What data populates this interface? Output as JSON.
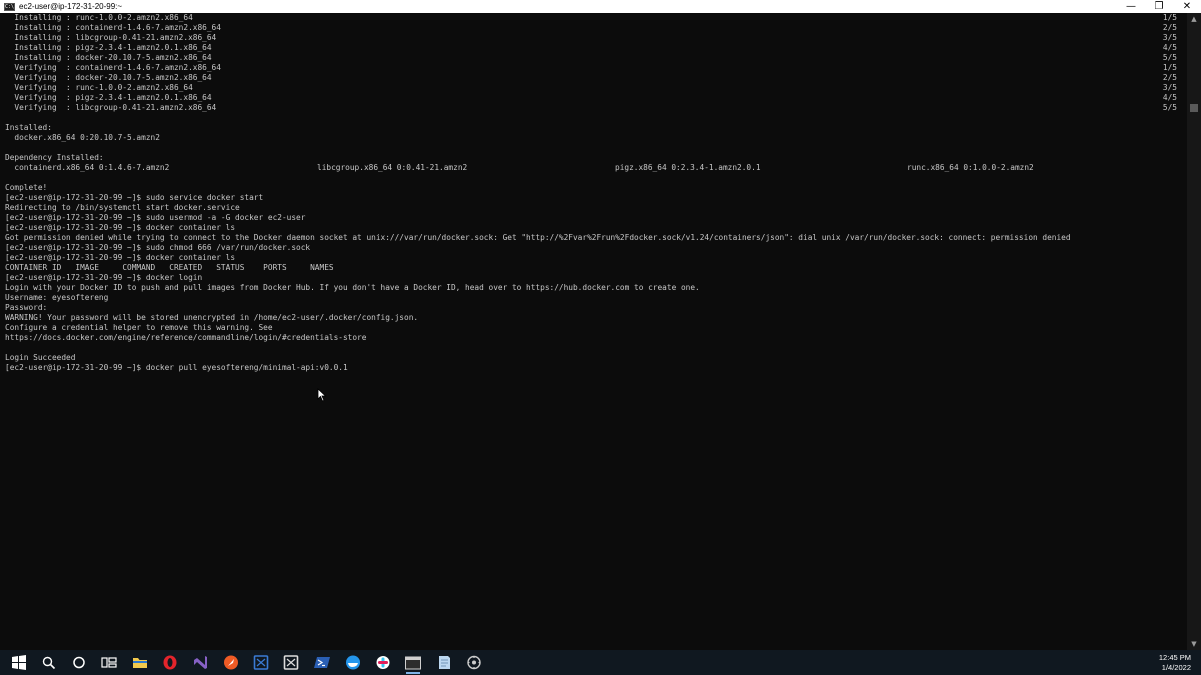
{
  "window": {
    "title": "ec2-user@ip-172-31-20-99:~",
    "app_icon_text": "C:\\",
    "minimize": "—",
    "restore": "❐",
    "close": "✕"
  },
  "terminal": {
    "lines": [
      "  Installing : runc-1.0.0-2.amzn2.x86_64",
      "  Installing : containerd-1.4.6-7.amzn2.x86_64",
      "  Installing : libcgroup-0.41-21.amzn2.x86_64",
      "  Installing : pigz-2.3.4-1.amzn2.0.1.x86_64",
      "  Installing : docker-20.10.7-5.amzn2.x86_64",
      "  Verifying  : containerd-1.4.6-7.amzn2.x86_64",
      "  Verifying  : docker-20.10.7-5.amzn2.x86_64",
      "  Verifying  : runc-1.0.0-2.amzn2.x86_64",
      "  Verifying  : pigz-2.3.4-1.amzn2.0.1.x86_64",
      "  Verifying  : libcgroup-0.41-21.amzn2.x86_64",
      "",
      "Installed:",
      "  docker.x86_64 0:20.10.7-5.amzn2",
      "",
      "Dependency Installed:",
      "",
      "",
      "Complete!",
      "[ec2-user@ip-172-31-20-99 ~]$ sudo service docker start",
      "Redirecting to /bin/systemctl start docker.service",
      "[ec2-user@ip-172-31-20-99 ~]$ sudo usermod -a -G docker ec2-user",
      "[ec2-user@ip-172-31-20-99 ~]$ docker container ls",
      "Got permission denied while trying to connect to the Docker daemon socket at unix:///var/run/docker.sock: Get \"http://%2Fvar%2Frun%2Fdocker.sock/v1.24/containers/json\": dial unix /var/run/docker.sock: connect: permission denied",
      "[ec2-user@ip-172-31-20-99 ~]$ sudo chmod 666 /var/run/docker.sock",
      "[ec2-user@ip-172-31-20-99 ~]$ docker container ls",
      "CONTAINER ID   IMAGE     COMMAND   CREATED   STATUS    PORTS     NAMES",
      "[ec2-user@ip-172-31-20-99 ~]$ docker login",
      "Login with your Docker ID to push and pull images from Docker Hub. If you don't have a Docker ID, head over to https://hub.docker.com to create one.",
      "Username: eyesoftereng",
      "Password:",
      "WARNING! Your password will be stored unencrypted in /home/ec2-user/.docker/config.json.",
      "Configure a credential helper to remove this warning. See",
      "https://docs.docker.com/engine/reference/commandline/login/#credentials-store",
      "",
      "Login Succeeded",
      "[ec2-user@ip-172-31-20-99 ~]$ docker pull eyesoftereng/minimal-api:v0.0.1"
    ],
    "progress": [
      "1/5",
      "2/5",
      "3/5",
      "4/5",
      "5/5",
      "1/5",
      "2/5",
      "3/5",
      "4/5",
      "5/5"
    ],
    "dependencies": [
      "  containerd.x86_64 0:1.4.6-7.amzn2",
      "libcgroup.x86_64 0:0.41-21.amzn2",
      "pigz.x86_64 0:2.3.4-1.amzn2.0.1",
      "runc.x86_64 0:1.0.0-2.amzn2"
    ]
  },
  "scrollbar": {
    "up_arrow": "▲",
    "down_arrow": "▼",
    "position_fraction": 0.13
  },
  "taskbar": {
    "items": [
      {
        "name": "start",
        "icon": "windows-logo"
      },
      {
        "name": "search",
        "icon": "search"
      },
      {
        "name": "cortana",
        "icon": "circle"
      },
      {
        "name": "task-view",
        "icon": "task-view"
      },
      {
        "name": "file-explorer",
        "icon": "folder",
        "color": "#f2c94c"
      },
      {
        "name": "opera",
        "icon": "opera",
        "color": "#e3242b"
      },
      {
        "name": "visual-studio",
        "icon": "visual-studio",
        "color": "#8661c5"
      },
      {
        "name": "postman",
        "icon": "postman",
        "color": "#ef5b25"
      },
      {
        "name": "app-blue",
        "icon": "app",
        "color": "#3a7bd5"
      },
      {
        "name": "app-white",
        "icon": "app",
        "color": "#dddddd"
      },
      {
        "name": "powershell",
        "icon": "powershell",
        "color": "#2a5fb4"
      },
      {
        "name": "docker",
        "icon": "docker",
        "color": "#2496ed"
      },
      {
        "name": "slack",
        "icon": "slack",
        "color": "#ffffff"
      },
      {
        "name": "terminal",
        "icon": "terminal",
        "color": "#2d2d2d",
        "active": true
      },
      {
        "name": "notepad",
        "icon": "notepad",
        "color": "#bcd7f0"
      },
      {
        "name": "app-gear",
        "icon": "gear",
        "color": "#cccccc"
      }
    ],
    "time": "12:45 PM",
    "date": "1/4/2022"
  }
}
